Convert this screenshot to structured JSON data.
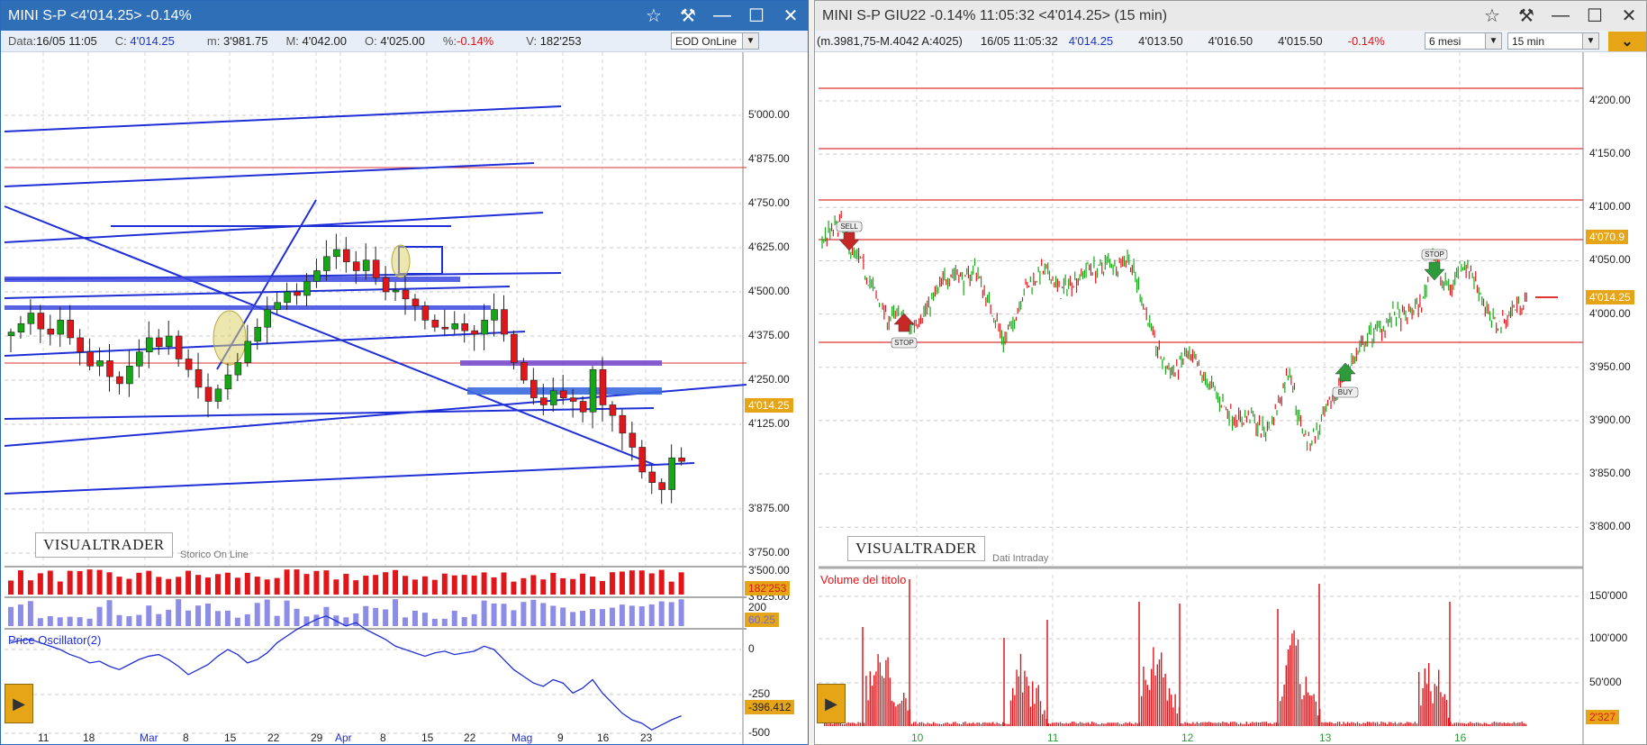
{
  "left_window": {
    "title": "MINI S-P <4'014.25> -0.14%",
    "info": {
      "data_label": "Data:",
      "data_value": "16/05 11:05",
      "c_label": "C:",
      "c_value": "4'014.25",
      "m_label": "m:",
      "m_value": "3'981.75",
      "M_label": "M:",
      "M_value": "4'042.00",
      "o_label": "O:",
      "o_value": "4'025.00",
      "pct_label": "%:",
      "pct_value": "-0.14%",
      "v_label": "V:",
      "v_value": "182'253"
    },
    "mode_select": "EOD OnLine",
    "logo": "VISUALTRADER",
    "sublabel": "Storico On Line",
    "price_axis": [
      "5'000.00",
      "4'875.00",
      "4'750.00",
      "4'625.00",
      "4'500.00",
      "4'375.00",
      "4'250.00",
      "4'125.00",
      "3'875.00",
      "3'750.00",
      "3'625.00"
    ],
    "last_price_tag": "4'014.25",
    "price_axis_hidden": "3'500.00",
    "volume_tag": "182'253",
    "osc2_top_label": "200",
    "osc2_tag": "60.25",
    "oscillator_title": "Price Oscillator(2)",
    "osc_axis": [
      "0",
      "-250",
      "-500"
    ],
    "osc_tag": "-396.412",
    "date_axis": [
      {
        "label": "11",
        "accent": false
      },
      {
        "label": "18",
        "accent": false
      },
      {
        "label": "Mar",
        "accent": true
      },
      {
        "label": "8",
        "accent": false
      },
      {
        "label": "15",
        "accent": false
      },
      {
        "label": "22",
        "accent": false
      },
      {
        "label": "29",
        "accent": false
      },
      {
        "label": "Apr",
        "accent": true
      },
      {
        "label": "8",
        "accent": false
      },
      {
        "label": "15",
        "accent": false
      },
      {
        "label": "22",
        "accent": false
      },
      {
        "label": "Mag",
        "accent": true
      },
      {
        "label": "9",
        "accent": false
      },
      {
        "label": "16",
        "accent": false
      },
      {
        "label": "23",
        "accent": false
      }
    ]
  },
  "right_window": {
    "title": "MINI S-P GIU22 -0.14% 11:05:32  <4'014.25> (15 min)",
    "info": {
      "range": "(m.3981,75-M.4042 A:4025)",
      "time": "16/05 11:05:32",
      "last": "4'014.25",
      "bid": "4'013.50",
      "ask": "4'016.50",
      "open": "4'015.50",
      "pct": "-0.14%"
    },
    "period_select": "6 mesi",
    "interval_select": "15 min",
    "logo": "VISUALTRADER",
    "sublabel": "Dati Intraday",
    "price_axis": [
      "4'200.00",
      "4'150.00",
      "4'100.00",
      "4'050.00",
      "4'000.00",
      "3'950.00",
      "3'900.00",
      "3'850.00",
      "3'800.00"
    ],
    "level_tag": "4'070.9",
    "last_price_tag": "4'014.25",
    "signals": {
      "sell": "SELL",
      "stop1": "STOP",
      "buy": "BUY",
      "stop2": "STOP"
    },
    "volume_title": "Volume del titolo",
    "volume_axis": [
      "150'000",
      "100'000",
      "50'000"
    ],
    "volume_tag": "2'327",
    "date_axis": [
      "10",
      "11",
      "12",
      "13",
      "16"
    ]
  },
  "colors": {
    "up": "#17a617",
    "down": "#e0161b",
    "trendline": "#1f2fd6",
    "accent": "#e6a516",
    "title_blue": "#2f6fb8"
  }
}
